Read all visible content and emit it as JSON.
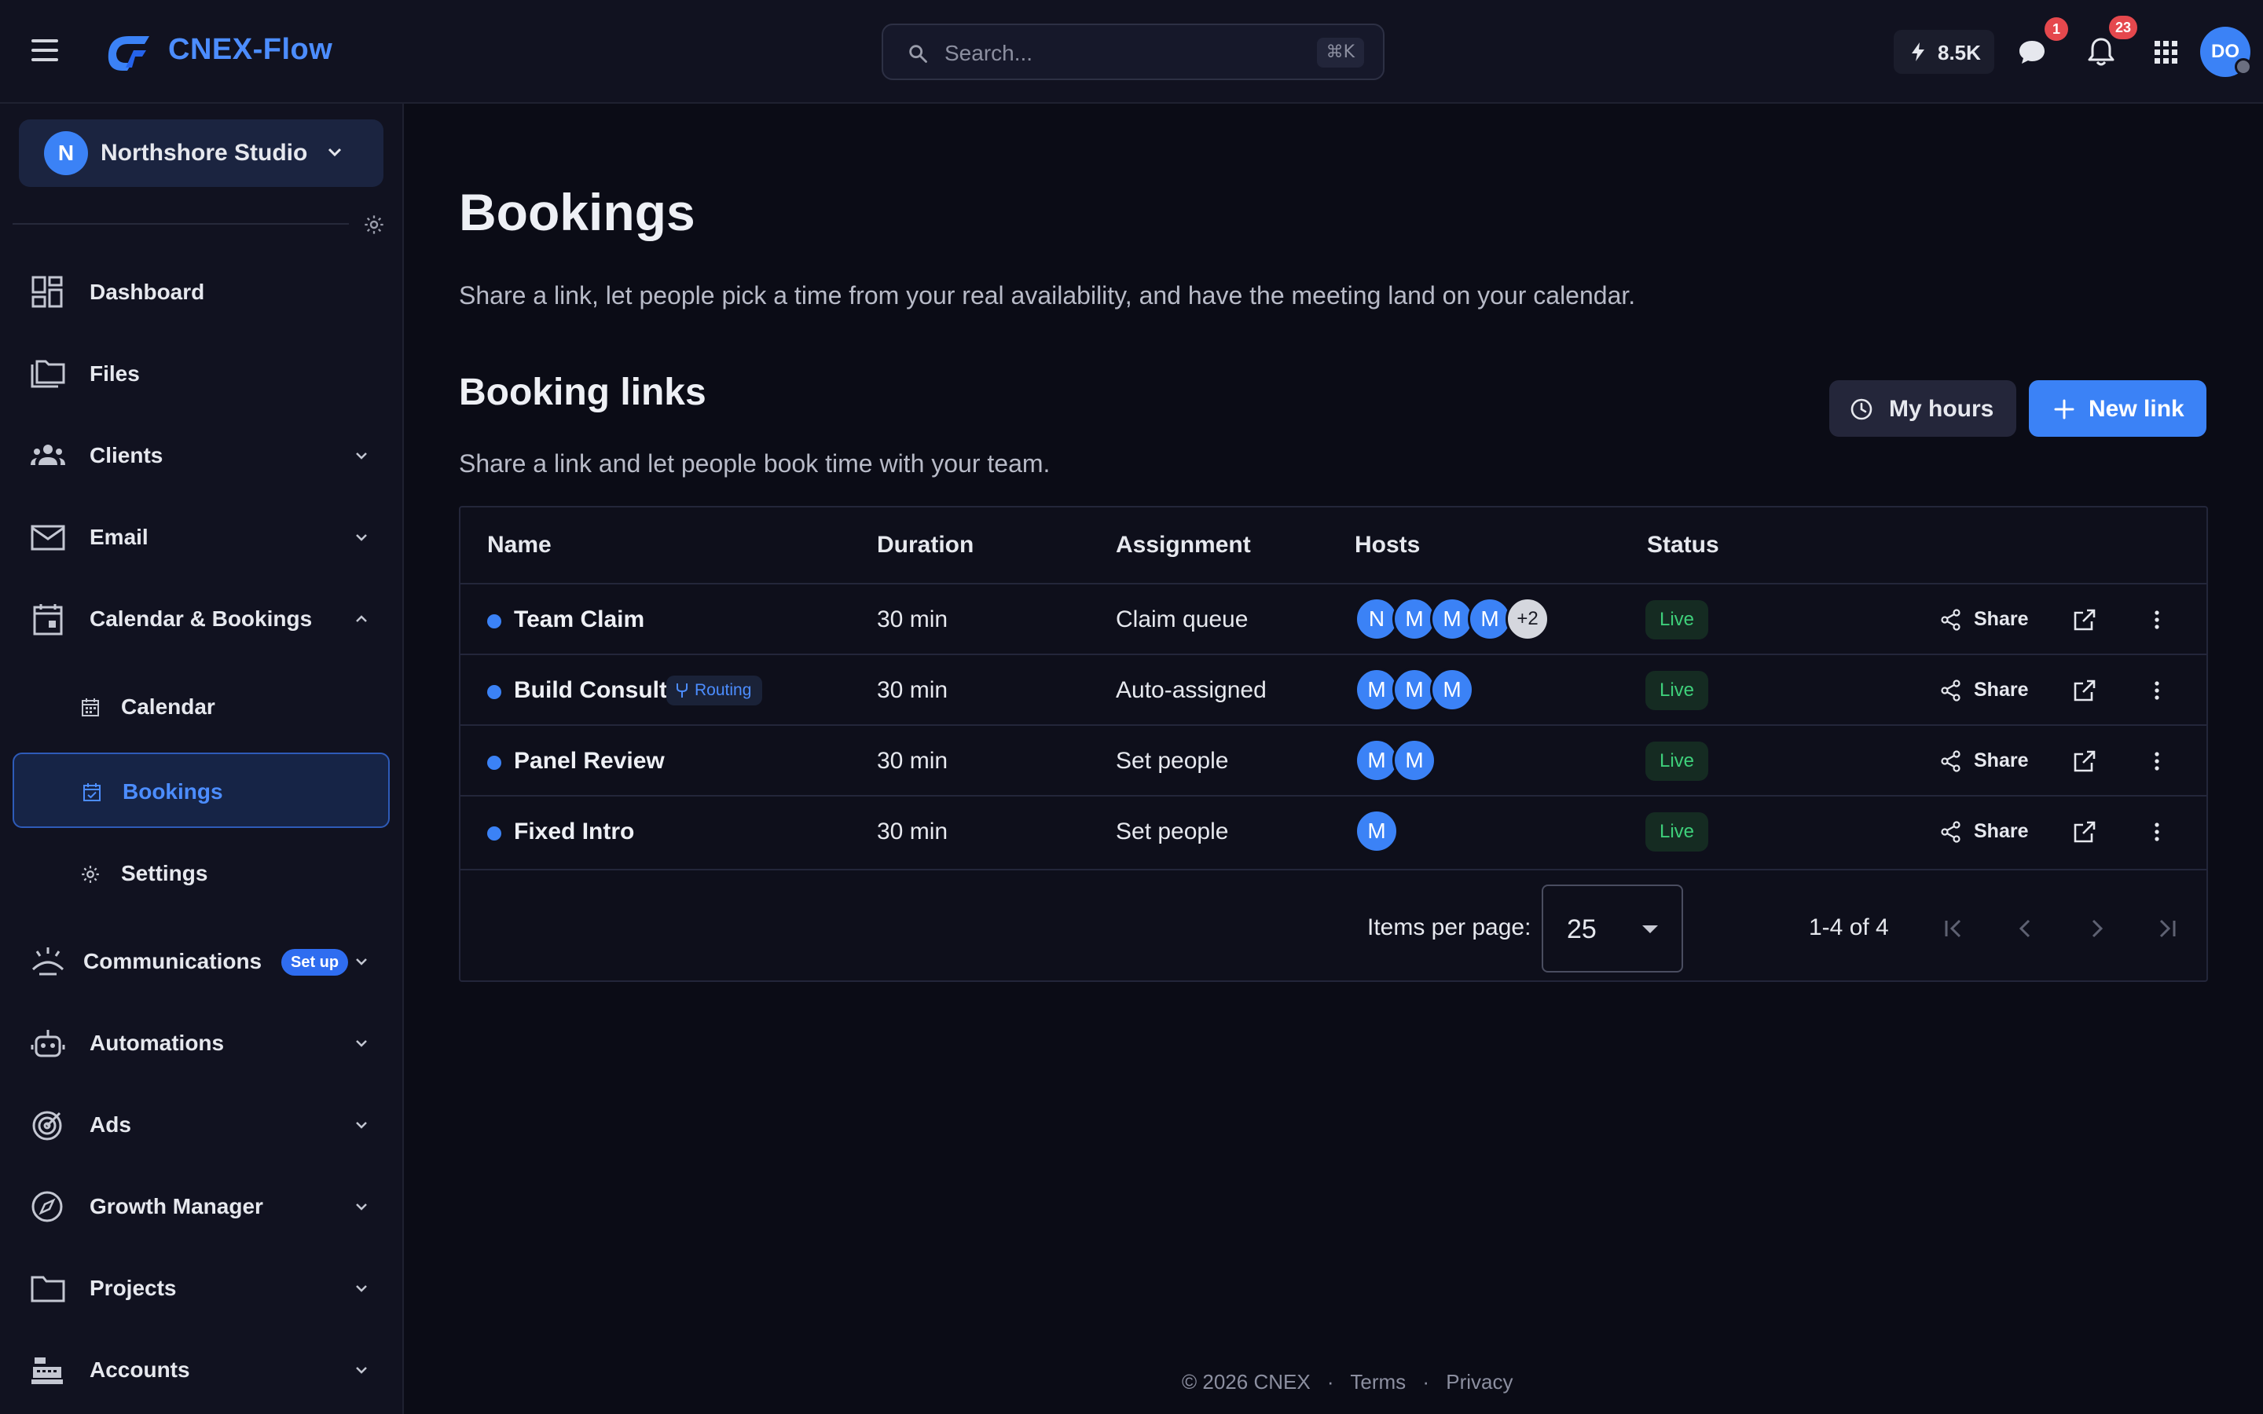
{
  "app": {
    "name": "CNEX-Flow"
  },
  "search": {
    "placeholder": "Search...",
    "shortcut": "⌘K"
  },
  "topbar": {
    "credits": "8.5K",
    "messages_badge": "1",
    "notifications_badge": "23",
    "user_initials": "DO"
  },
  "colors": {
    "accent": "#3b82f6",
    "live": "#3ecf7a",
    "badge": "#e5484d"
  },
  "sidebar": {
    "org": {
      "initial": "N",
      "name": "Northshore Studio"
    },
    "items": [
      {
        "label": "Dashboard",
        "icon": "dashboard-icon"
      },
      {
        "label": "Files",
        "icon": "files-icon"
      },
      {
        "label": "Clients",
        "icon": "clients-icon"
      },
      {
        "label": "Email",
        "icon": "email-icon"
      },
      {
        "label": "Calendar & Bookings",
        "icon": "calendar-icon"
      },
      {
        "label": "Communications",
        "icon": "communications-icon",
        "badge": "Set up"
      },
      {
        "label": "Automations",
        "icon": "robot-icon"
      },
      {
        "label": "Ads",
        "icon": "target-icon"
      },
      {
        "label": "Growth Manager",
        "icon": "compass-icon"
      },
      {
        "label": "Projects",
        "icon": "folder-icon"
      },
      {
        "label": "Accounts",
        "icon": "register-icon"
      }
    ],
    "sub_items": [
      {
        "label": "Calendar",
        "icon": "calendar-small-icon"
      },
      {
        "label": "Bookings",
        "icon": "bookings-icon",
        "active": true
      },
      {
        "label": "Settings",
        "icon": "settings-icon"
      }
    ]
  },
  "main": {
    "title": "Bookings",
    "description": "Share a link, let people pick a time from your real availability, and have the meeting land on your calendar.",
    "section_title": "Booking links",
    "section_description": "Share a link and let people book time with your team.",
    "my_hours_label": "My hours",
    "new_link_label": "New link"
  },
  "table": {
    "headers": [
      "Name",
      "Duration",
      "Assignment",
      "Hosts",
      "Status"
    ],
    "rows": [
      {
        "name": "Team Claim",
        "duration": "30 min",
        "assignment": "Claim queue",
        "hosts": [
          "N",
          "M",
          "M",
          "M"
        ],
        "hosts_more": "+2",
        "status": "Live",
        "share": "Share"
      },
      {
        "name": "Build Consult",
        "tag": "Routing",
        "duration": "30 min",
        "assignment": "Auto-assigned",
        "hosts": [
          "M",
          "M",
          "M"
        ],
        "status": "Live",
        "share": "Share"
      },
      {
        "name": "Panel Review",
        "duration": "30 min",
        "assignment": "Set people",
        "hosts": [
          "M",
          "M"
        ],
        "status": "Live",
        "share": "Share"
      },
      {
        "name": "Fixed Intro",
        "duration": "30 min",
        "assignment": "Set people",
        "hosts": [
          "M"
        ],
        "status": "Live",
        "share": "Share"
      }
    ],
    "pagination": {
      "items_per_page_label": "Items per page:",
      "items_per_page": "25",
      "range": "1-4 of 4"
    }
  },
  "footer": {
    "copyright": "© 2026 CNEX",
    "terms": "Terms",
    "privacy": "Privacy",
    "separator": "·"
  }
}
